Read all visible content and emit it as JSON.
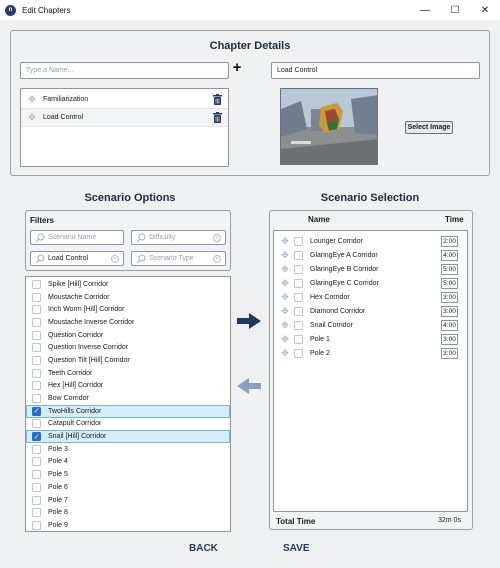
{
  "window": {
    "title": "Edit Chapters",
    "icon_glyph": "n",
    "controls": {
      "minimize": "—",
      "maximize": "☐",
      "close": "✕"
    }
  },
  "chapter_details": {
    "title": "Chapter Details",
    "name_placeholder": "Type a Name...",
    "add_symbol": "+",
    "selected_name": "Load Control",
    "chapters": [
      {
        "label": "Familiarization"
      },
      {
        "label": "Load Control"
      }
    ],
    "select_image_label": "Select Image"
  },
  "scenario_options": {
    "title": "Scenario Options",
    "filters": {
      "heading": "Filters",
      "scenario_name_placeholder": "Scenario Name",
      "difficulty_placeholder": "Difficulty",
      "load_control_value": "Load Control",
      "scenario_type_placeholder": "Scenario Type"
    },
    "items": [
      {
        "label": "Spike [Hill] Corridor",
        "checked": false
      },
      {
        "label": "Moustache Corridor",
        "checked": false
      },
      {
        "label": "Inch Worm [Hill] Corridor",
        "checked": false
      },
      {
        "label": "Moustache Inverse Corridor",
        "checked": false
      },
      {
        "label": "Question Corridor",
        "checked": false
      },
      {
        "label": "Question Inverse Corridor",
        "checked": false
      },
      {
        "label": "Question Tilt [Hill] Corridor",
        "checked": false
      },
      {
        "label": "Teeth Corridor",
        "checked": false
      },
      {
        "label": "Hex [Hill] Corridor",
        "checked": false
      },
      {
        "label": "Bow Corridor",
        "checked": false
      },
      {
        "label": "TwoHills Corridor",
        "checked": true
      },
      {
        "label": "Catapult Corridor",
        "checked": false
      },
      {
        "label": "Snail [Hill] Corridor",
        "checked": true
      },
      {
        "label": "Pole 3",
        "checked": false
      },
      {
        "label": "Pole 4",
        "checked": false
      },
      {
        "label": "Pole 5",
        "checked": false
      },
      {
        "label": "Pole 6",
        "checked": false
      },
      {
        "label": "Pole 7",
        "checked": false
      },
      {
        "label": "Pole 8",
        "checked": false
      },
      {
        "label": "Pole 9",
        "checked": false
      }
    ]
  },
  "scenario_selection": {
    "title": "Scenario Selection",
    "col_name": "Name",
    "col_time": "Time",
    "items": [
      {
        "label": "Lounger Corridor",
        "time": "2:00"
      },
      {
        "label": "GlaringEye A Corridor",
        "time": "4:00"
      },
      {
        "label": "GlaringEye B Corridor",
        "time": "5:00"
      },
      {
        "label": "GlaringEye C Corridor",
        "time": "5:00"
      },
      {
        "label": "Hex Corridor",
        "time": "3:00"
      },
      {
        "label": "Diamond Corridor",
        "time": "3:00"
      },
      {
        "label": "Snail Corridor",
        "time": "4:00"
      },
      {
        "label": "Pole 1",
        "time": "3:00"
      },
      {
        "label": "Pole 2",
        "time": "3:00"
      }
    ],
    "total_label": "Total Time",
    "total_value": "32m 0s"
  },
  "footer": {
    "back_label": "BACK",
    "save_label": "SAVE"
  },
  "colors": {
    "accent_dark": "#1f3a5f",
    "check_blue": "#1f6fc4",
    "highlight": "#d6ecf8",
    "arrow_disabled": "#8aa1bd"
  },
  "icons": [
    "app-icon",
    "drag-handle-icon",
    "trash-icon",
    "search-icon",
    "clear-icon",
    "arrow-right-icon",
    "arrow-left-icon"
  ]
}
